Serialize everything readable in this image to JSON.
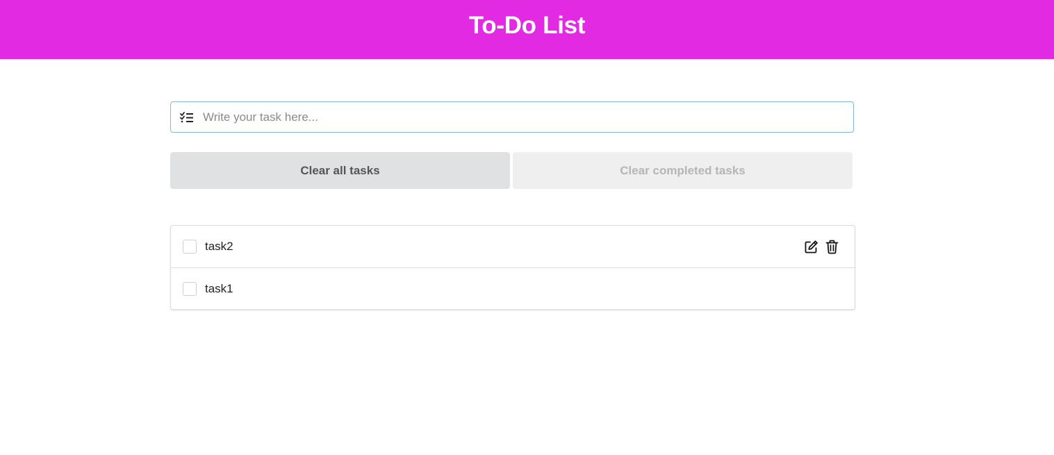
{
  "header": {
    "title": "To-Do List",
    "background_color": "#e32ae3"
  },
  "task_input": {
    "icon": "tasks-icon",
    "placeholder": "Write your task here...",
    "value": ""
  },
  "buttons": {
    "clear_all_label": "Clear all tasks",
    "clear_completed_label": "Clear completed tasks",
    "clear_completed_enabled": false
  },
  "tasks": [
    {
      "label": "task2",
      "completed": false,
      "actions": [
        "edit-icon",
        "trash-icon"
      ]
    },
    {
      "label": "task1",
      "completed": false,
      "actions": []
    }
  ]
}
